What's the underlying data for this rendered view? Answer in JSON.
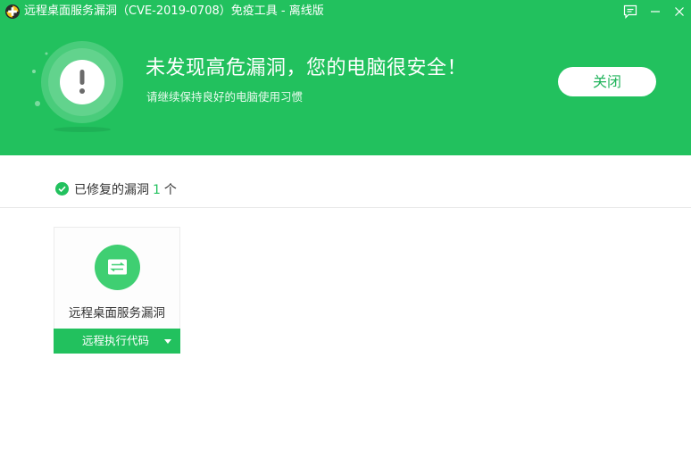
{
  "window": {
    "title": "远程桌面服务漏洞（CVE-2019-0708）免疫工具 - 离线版"
  },
  "result": {
    "headline": "未发现高危漏洞，您的电脑很安全！",
    "subline": "请继续保持良好的电脑使用习惯",
    "close_label": "关闭"
  },
  "summary": {
    "prefix": "已修复的漏洞",
    "count": "1",
    "suffix": "个"
  },
  "vulnerabilities": [
    {
      "name": "远程桌面服务漏洞",
      "type": "远程执行代码"
    }
  ],
  "colors": {
    "brand_green": "#22c15e",
    "button_text": "#22b45c"
  },
  "icons": {
    "app": "app-logo-icon",
    "feedback": "feedback-icon",
    "minimize": "minimize-icon",
    "close": "close-icon",
    "status": "exclamation-icon",
    "summary": "check-circle-icon",
    "vulnerability": "remote-desktop-icon",
    "dropdown": "caret-down-icon"
  }
}
